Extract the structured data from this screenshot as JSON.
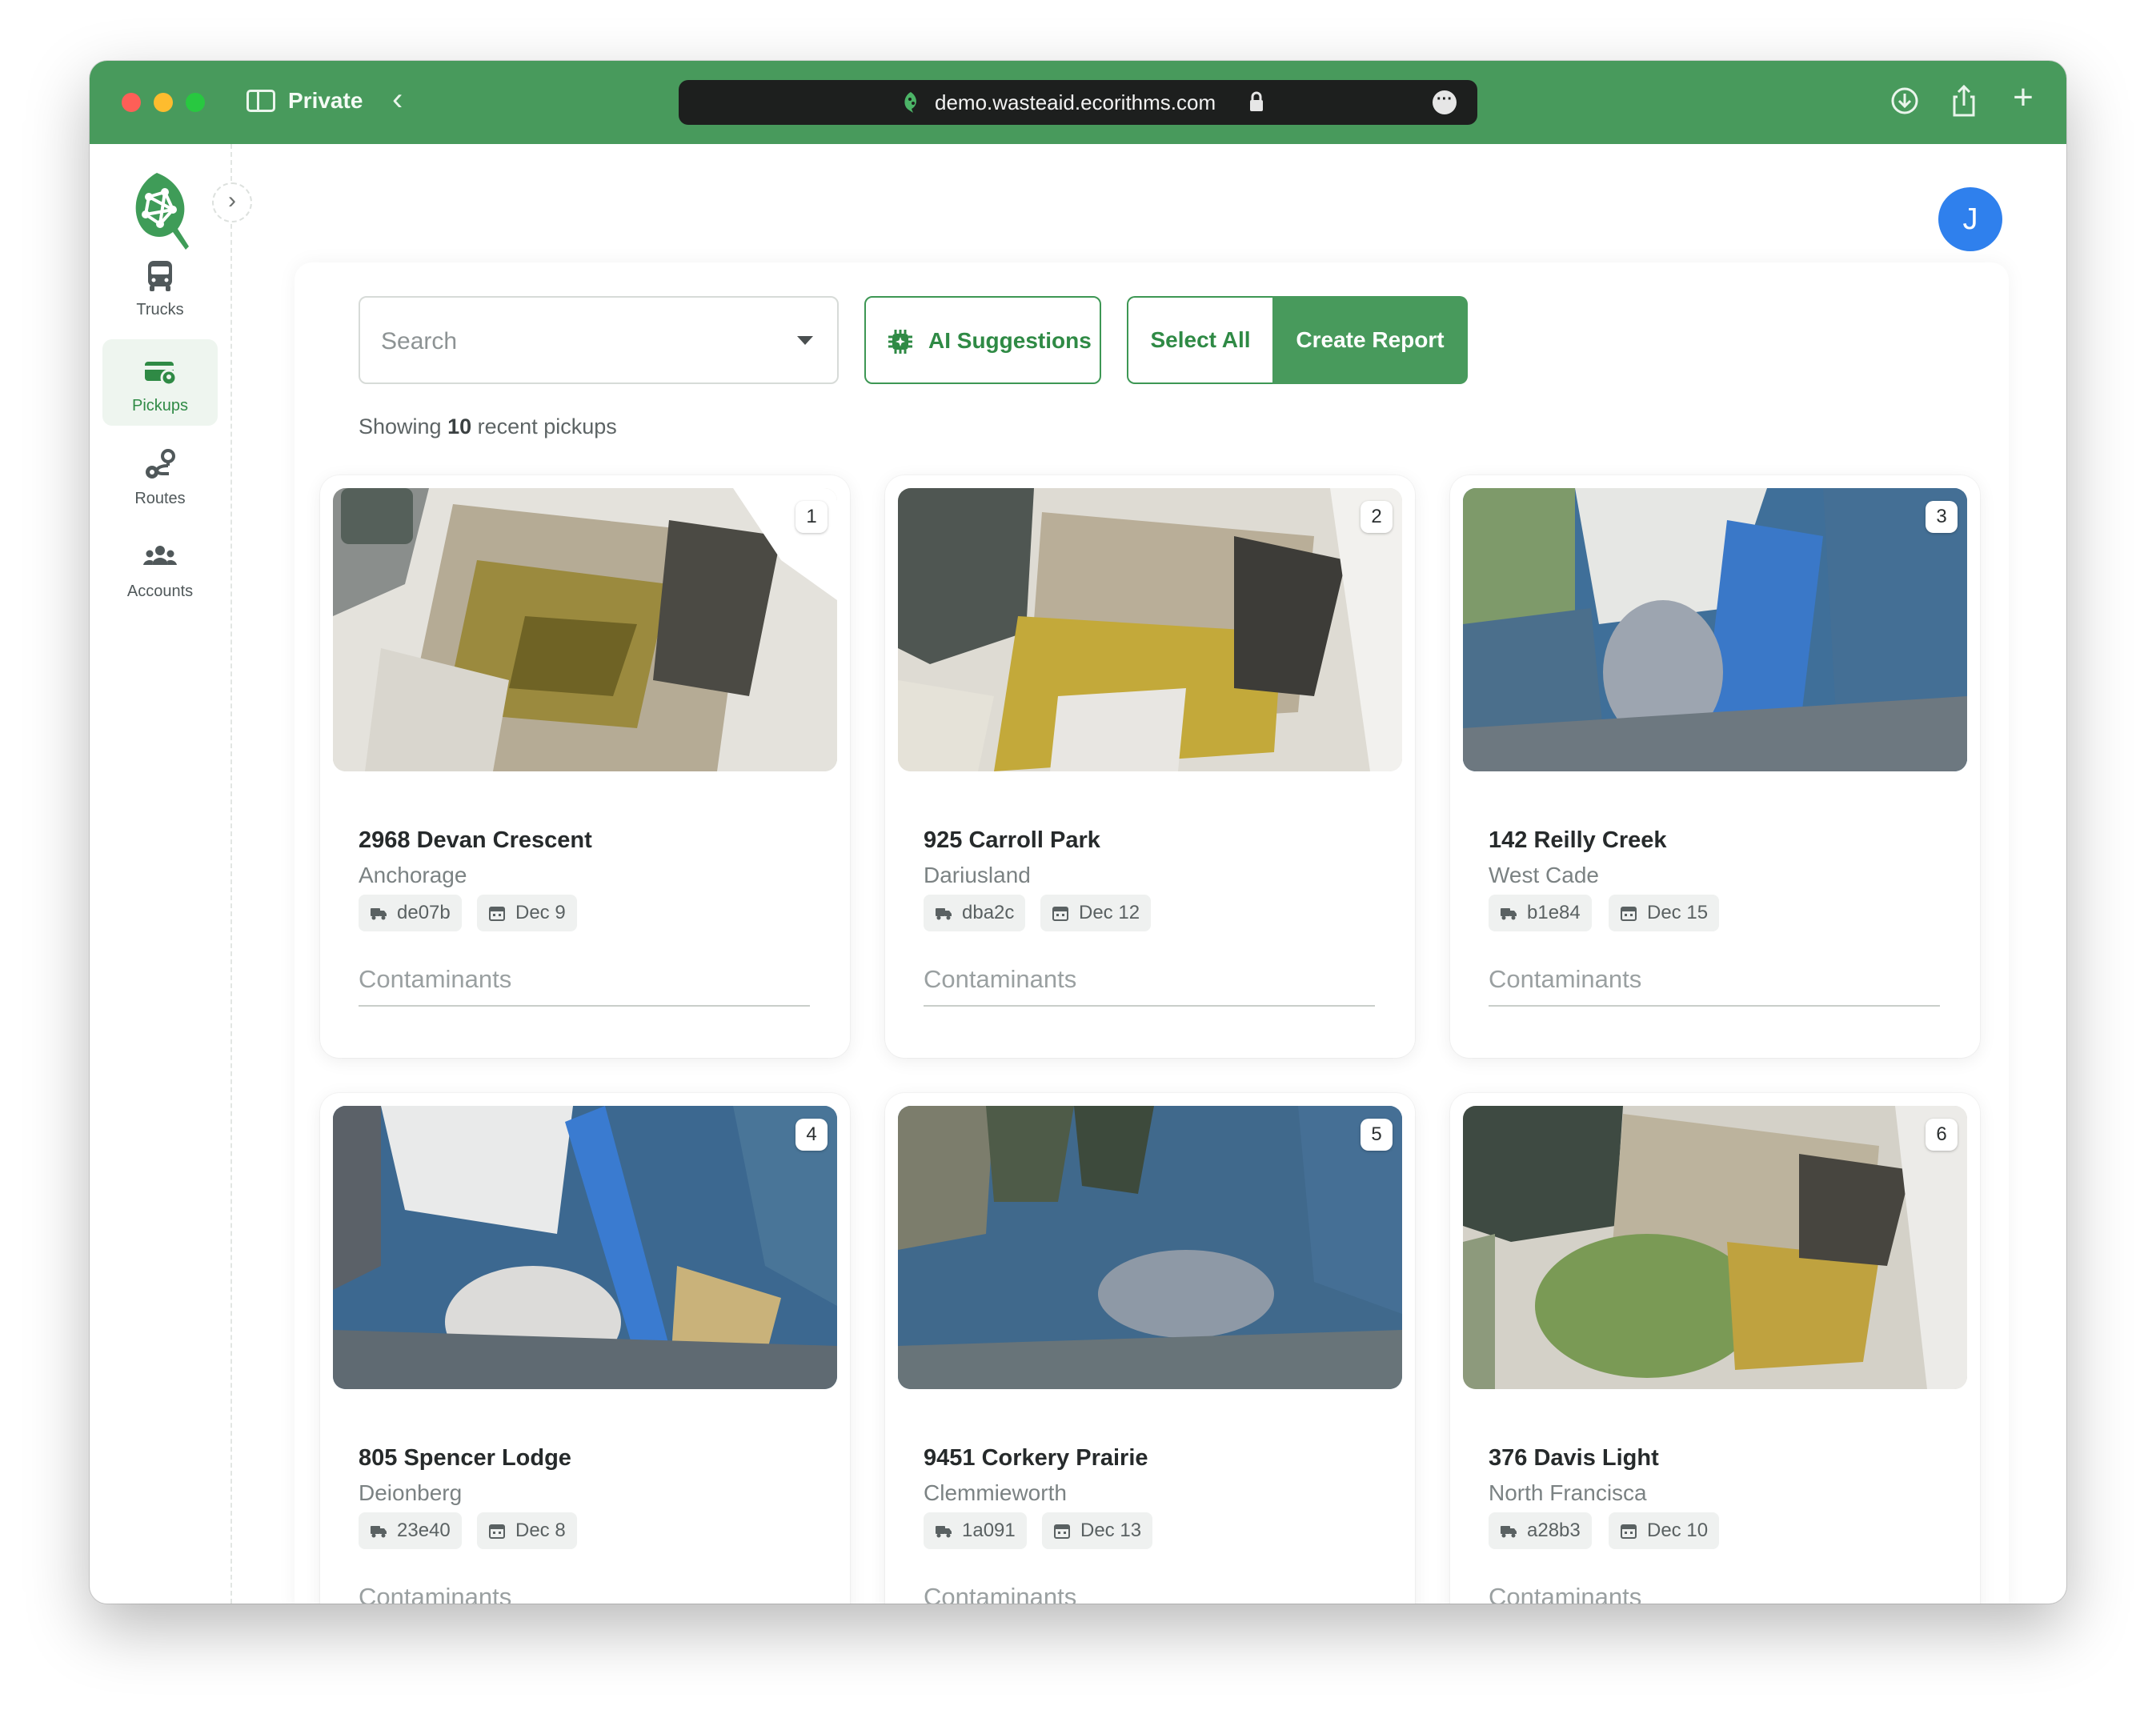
{
  "browser": {
    "mode_label": "Private",
    "url": "demo.wasteaid.ecorithms.com"
  },
  "sidebar": {
    "items": [
      {
        "label": "Trucks",
        "icon": "bus-icon",
        "active": false
      },
      {
        "label": "Pickups",
        "icon": "pickups-icon",
        "active": true
      },
      {
        "label": "Routes",
        "icon": "route-icon",
        "active": false
      },
      {
        "label": "Accounts",
        "icon": "users-icon",
        "active": false
      }
    ]
  },
  "user": {
    "avatar_initial": "J"
  },
  "toolbar": {
    "search_placeholder": "Search",
    "ai_label": "AI Suggestions",
    "select_all_label": "Select All",
    "create_report_label": "Create Report"
  },
  "summary": {
    "prefix": "Showing",
    "count": "10",
    "suffix": "recent pickups"
  },
  "pickups": [
    {
      "index": "1",
      "address": "2968 Devan Crescent",
      "city": "Anchorage",
      "truck": "de07b",
      "date": "Dec 9",
      "contaminants_placeholder": "Contaminants"
    },
    {
      "index": "2",
      "address": "925 Carroll Park",
      "city": "Dariusland",
      "truck": "dba2c",
      "date": "Dec 12",
      "contaminants_placeholder": "Contaminants"
    },
    {
      "index": "3",
      "address": "142 Reilly Creek",
      "city": "West Cade",
      "truck": "b1e84",
      "date": "Dec 15",
      "contaminants_placeholder": "Contaminants"
    },
    {
      "index": "4",
      "address": "805 Spencer Lodge",
      "city": "Deionberg",
      "truck": "23e40",
      "date": "Dec 8",
      "contaminants_placeholder": "Contaminants"
    },
    {
      "index": "5",
      "address": "9451 Corkery Prairie",
      "city": "Clemmieworth",
      "truck": "1a091",
      "date": "Dec 13",
      "contaminants_placeholder": "Contaminants"
    },
    {
      "index": "6",
      "address": "376 Davis Light",
      "city": "North Francisca",
      "truck": "a28b3",
      "date": "Dec 10",
      "contaminants_placeholder": "Contaminants"
    }
  ],
  "colors": {
    "brand_green": "#489a5c",
    "brand_text_green": "#2f8a45",
    "avatar_blue": "#2f80ed"
  }
}
